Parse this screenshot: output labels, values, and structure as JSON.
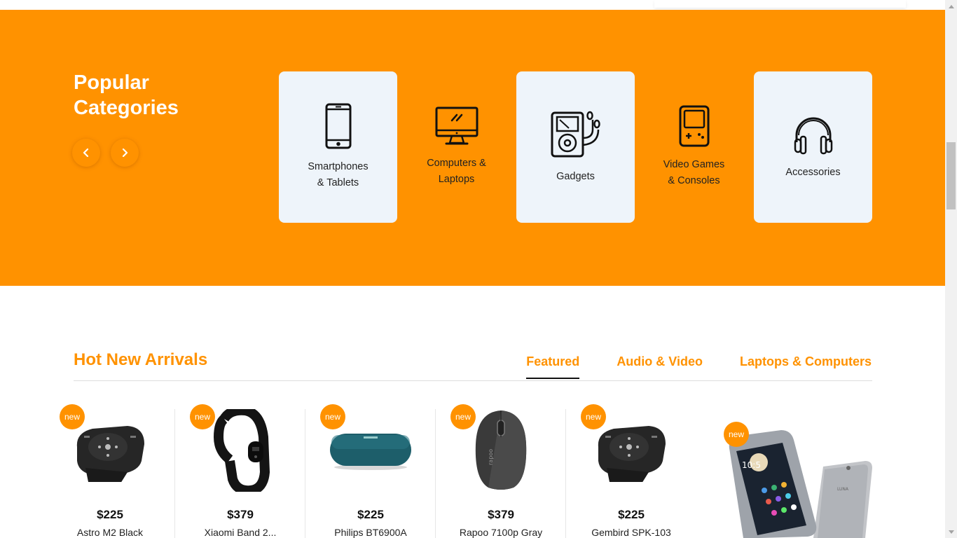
{
  "categories": {
    "title": "Popular\nCategories",
    "prev_icon": "chevron-left-icon",
    "next_icon": "chevron-right-icon",
    "items": [
      {
        "label": "Smartphones\n& Tablets",
        "icon": "smartphone-icon",
        "highlighted": true
      },
      {
        "label": "Computers &\nLaptops",
        "icon": "monitor-icon",
        "highlighted": false
      },
      {
        "label": "Gadgets",
        "icon": "music-player-icon",
        "highlighted": true
      },
      {
        "label": "Video Games\n& Consoles",
        "icon": "handheld-console-icon",
        "highlighted": false
      },
      {
        "label": "Accessories",
        "icon": "headphones-icon",
        "highlighted": true
      }
    ]
  },
  "arrivals": {
    "title": "Hot New Arrivals",
    "tabs": [
      {
        "label": "Featured",
        "active": true
      },
      {
        "label": "Audio & Video",
        "active": false
      },
      {
        "label": "Laptops & Computers",
        "active": false
      }
    ],
    "badge": "new",
    "products": [
      {
        "price": "$225",
        "name": "Astro M2 Black",
        "image": "black-portable-player"
      },
      {
        "price": "$379",
        "name": "Xiaomi Band 2...",
        "image": "black-fitness-band"
      },
      {
        "price": "$225",
        "name": "Philips BT6900A",
        "image": "teal-speaker"
      },
      {
        "price": "$379",
        "name": "Rapoo 7100p Gray",
        "image": "gray-mouse"
      },
      {
        "price": "$225",
        "name": "Gembird SPK-103",
        "image": "black-portable-player"
      }
    ],
    "featured_image": "silver-smartphones"
  },
  "colors": {
    "accent": "#ff9200",
    "card_bg": "#eef4fa",
    "text": "#222222"
  }
}
